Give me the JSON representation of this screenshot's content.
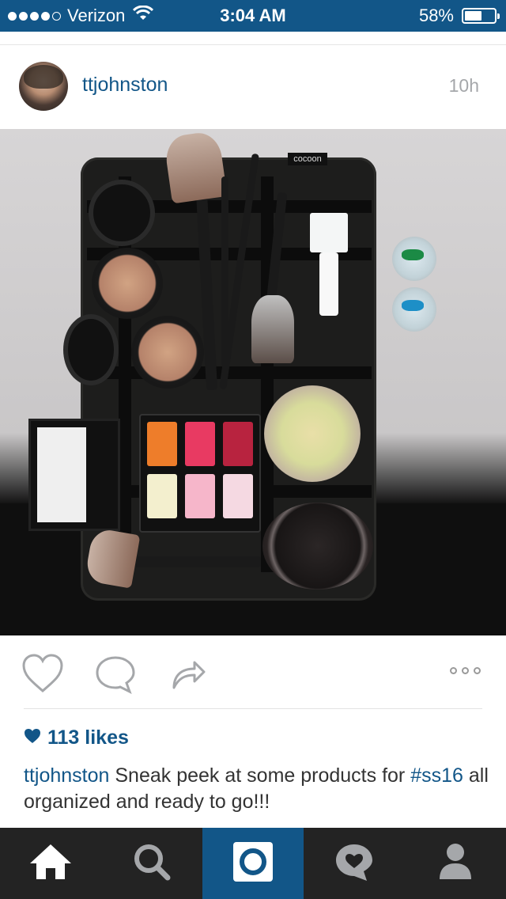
{
  "status_bar": {
    "carrier": "Verizon",
    "time": "3:04 AM",
    "battery": "58%",
    "battery_level": 0.58,
    "signal_bars": 4,
    "signal_total": 5
  },
  "post": {
    "username": "ttjohnston",
    "time_ago": "10h",
    "likes": "113 likes",
    "caption_user": "ttjohnston",
    "caption_text": "Sneak peek at some products for",
    "caption_hashtag": "#ss16",
    "caption_rest": "all organized and ready to go!!!"
  },
  "photo": {
    "brand_label": "cocoon"
  },
  "tabs": [
    {
      "name": "home-icon"
    },
    {
      "name": "search-icon"
    },
    {
      "name": "camera-icon"
    },
    {
      "name": "activity-icon"
    },
    {
      "name": "profile-icon"
    }
  ],
  "colors": {
    "accent": "#125688",
    "tabbar": "#232323",
    "muted": "#a5a7aa"
  }
}
